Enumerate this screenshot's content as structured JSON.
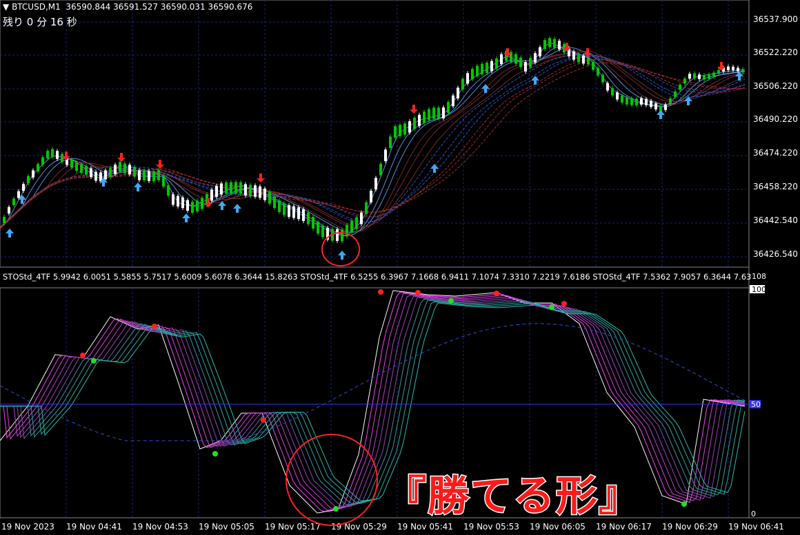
{
  "main_chart": {
    "symbol_label": "BTCUSD,M1",
    "ohlc": "36590.844 36591.527 36590.031 36590.676",
    "countdown": "残り 0 分 16 秒",
    "price_ticks": [
      "36537.900",
      "36522.220",
      "36506.220",
      "36490.220",
      "36474.220",
      "36458.220",
      "36442.540",
      "36426.540"
    ]
  },
  "indicator": {
    "name_values": "STOStd_4TF 5.9942 6.0051 5.5855 5.7517 5.6009 5.6078 6.3644 15.8263  STOStd_4TF 6.5255 6.3967 7.1668 6.9411 7.1074 7.3310 7.2219 7.6186  STOStd_4TF 7.5362 7.9057 6.3644 7.63",
    "level_108": "108",
    "level_100": "100",
    "level_50": "50",
    "level_0": "0"
  },
  "time_axis": [
    "19 Nov 2023",
    "19 Nov 04:41",
    "19 Nov 04:53",
    "19 Nov 05:05",
    "19 Nov 05:17",
    "19 Nov 05:29",
    "19 Nov 05:41",
    "19 Nov 05:53",
    "19 Nov 06:05",
    "19 Nov 06:17",
    "19 Nov 06:29",
    "19 Nov 06:41"
  ],
  "annotation": {
    "banner_text": "『勝てる形』"
  },
  "colors": {
    "bull": "#00c800",
    "bear": "#ffffff",
    "grid": "#1a237e",
    "sell_arrow": "#ff2020",
    "buy_arrow": "#3fa9f5",
    "circle": "#ff2020"
  }
}
